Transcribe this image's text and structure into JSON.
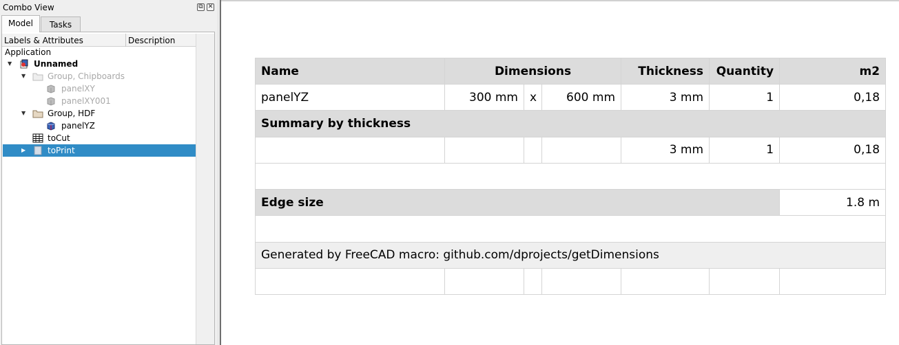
{
  "combo_view": {
    "title": "Combo View",
    "tabs": [
      {
        "label": "Model"
      },
      {
        "label": "Tasks"
      }
    ],
    "columns": [
      "Labels & Attributes",
      "Description"
    ],
    "tree": {
      "root_label": "Application",
      "document": "Unnamed",
      "groups": [
        {
          "label": "Group, Chipboards",
          "children": [
            "panelXY",
            "panelXY001"
          ]
        },
        {
          "label": "Group, HDF",
          "children": [
            "panelYZ"
          ]
        }
      ],
      "spreadsheet": "toCut",
      "page": "toPrint"
    }
  },
  "spreadsheet": {
    "header": {
      "name": "Name",
      "dimensions": "Dimensions",
      "thickness": "Thickness",
      "quantity": "Quantity",
      "area": "m2"
    },
    "rows": [
      {
        "name": "panelYZ",
        "dim1": "300 mm",
        "sep": "x",
        "dim2": "600 mm",
        "thickness": "3 mm",
        "quantity": "1",
        "area": "0,18"
      }
    ],
    "summary_title": "Summary by thickness",
    "summary": {
      "thickness": "3 mm",
      "quantity": "1",
      "area": "0,18"
    },
    "edge_title": "Edge size",
    "edge_value": "1.8 m",
    "footer": "Generated by FreeCAD macro: github.com/dprojects/getDimensions"
  }
}
